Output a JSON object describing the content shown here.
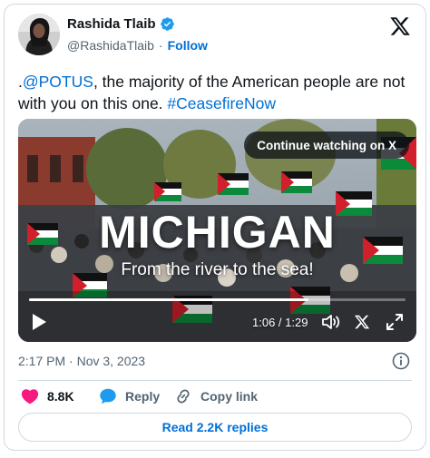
{
  "author": {
    "name": "Rashida Tlaib",
    "handle": "@RashidaTlaib",
    "separator": "·",
    "follow_label": "Follow"
  },
  "tweet": {
    "text_prefix": ".",
    "mention": "@POTUS",
    "text_body": ", the majority of the American people are not with you on this one. ",
    "hashtag": "#CeasefireNow"
  },
  "video": {
    "continue_label": "Continue watching on X",
    "overlay_title": "MICHIGAN",
    "overlay_subtitle": "From the river to the sea!",
    "time_display": "1:06 / 1:29",
    "progress_fraction": 0.742
  },
  "meta": {
    "timestamp": "2:17 PM · Nov 3, 2023"
  },
  "actions": {
    "like_count": "8.8K",
    "reply_label": "Reply",
    "copy_label": "Copy link"
  },
  "read_replies_label": "Read 2.2K replies",
  "colors": {
    "link_blue": "#006fd6",
    "like_pink": "#f91880",
    "verified_blue": "#1d9bf0",
    "text_secondary": "#536471"
  }
}
